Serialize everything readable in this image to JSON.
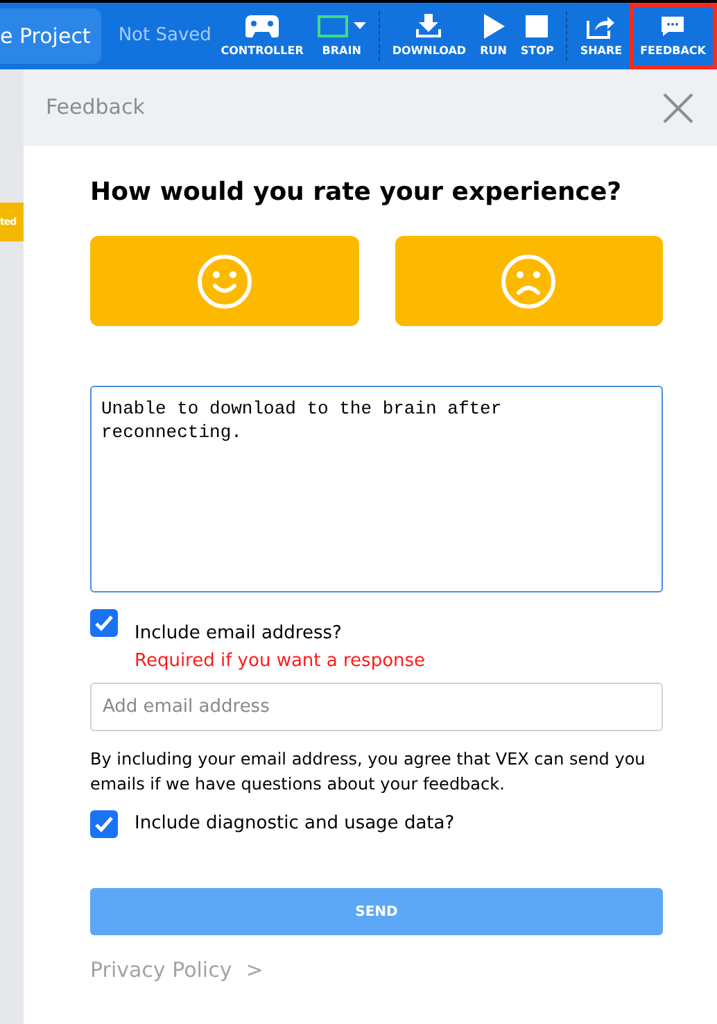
{
  "toolbar": {
    "project_button": "e Project",
    "save_status": "Not Saved",
    "tools": [
      {
        "kind": "controller",
        "label": "CONTROLLER",
        "selected": false
      },
      {
        "kind": "brain",
        "label": "BRAIN",
        "selected": false
      },
      {
        "kind": "divider"
      },
      {
        "kind": "download",
        "label": "DOWNLOAD",
        "selected": false
      },
      {
        "kind": "run",
        "label": "RUN",
        "selected": false
      },
      {
        "kind": "stop",
        "label": "STOP",
        "selected": false
      },
      {
        "kind": "divider"
      },
      {
        "kind": "share",
        "label": "SHARE",
        "selected": false
      },
      {
        "kind": "feedback",
        "label": "FEEDBACK",
        "selected": true
      }
    ]
  },
  "side_tab": "ted",
  "dialog": {
    "title": "Feedback",
    "question": "How would you rate your experience?",
    "ratings": [
      {
        "kind": "happy",
        "selected": false
      },
      {
        "kind": "sad",
        "selected": false
      }
    ],
    "comment": "Unable to download to the brain after reconnecting.",
    "include_email": {
      "label": "Include email address?",
      "note": "Required if you want a response",
      "checked": true
    },
    "email": {
      "placeholder": "Add email address"
    },
    "consent": "By including your email address, you agree that VEX can send you emails if we have questions about your feedback.",
    "include_diagnostics": {
      "label": "Include diagnostic and usage data?",
      "checked": true
    },
    "send_button": "SEND",
    "privacy_link": "Privacy Policy",
    "privacy_chevron": ">"
  }
}
